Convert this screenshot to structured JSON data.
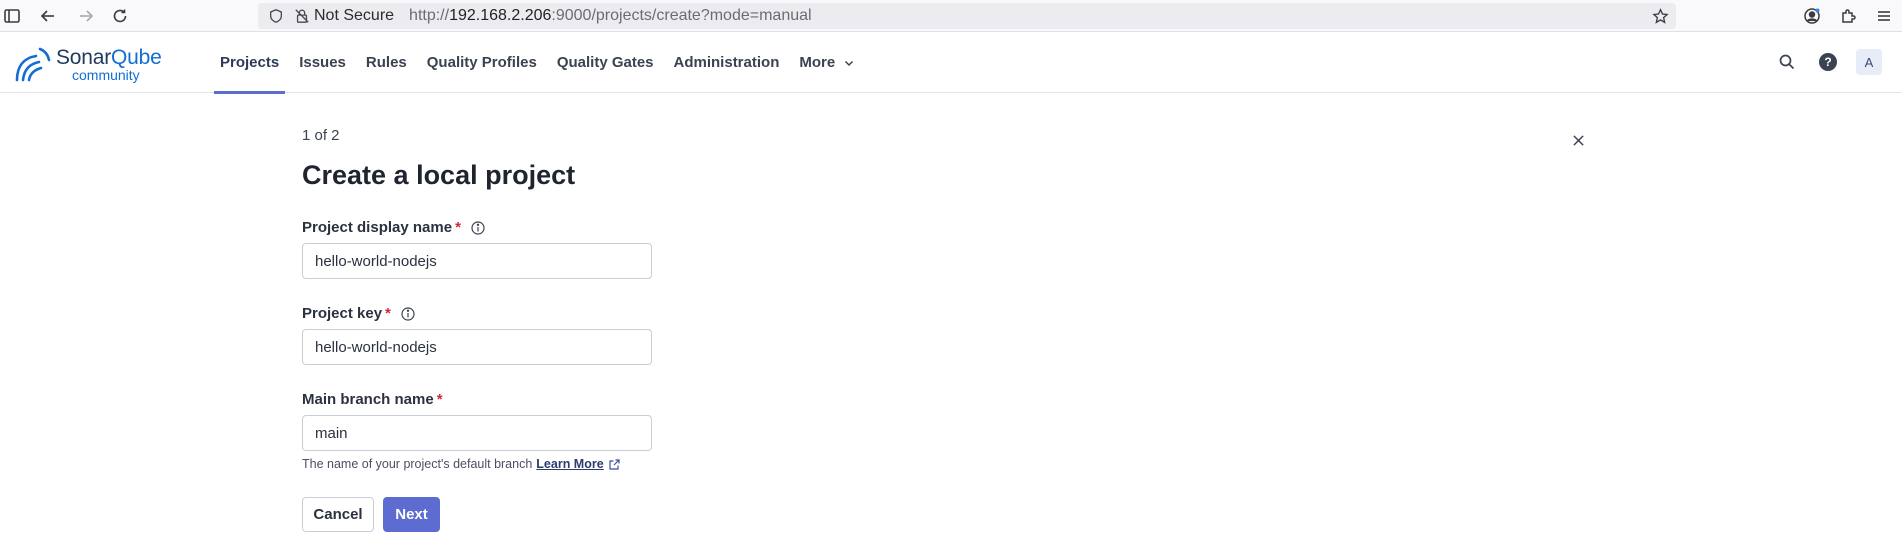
{
  "browser": {
    "not_secure_label": "Not Secure",
    "url_prefix": "http://",
    "url_host": "192.168.2.206",
    "url_rest": ":9000/projects/create?mode=manual"
  },
  "app": {
    "logo": {
      "brand_a": "Sonar",
      "brand_b": "Qube",
      "edition": "community"
    },
    "nav": [
      {
        "label": "Projects"
      },
      {
        "label": "Issues"
      },
      {
        "label": "Rules"
      },
      {
        "label": "Quality Profiles"
      },
      {
        "label": "Quality Gates"
      },
      {
        "label": "Administration"
      },
      {
        "label": "More"
      }
    ],
    "avatar_initial": "A",
    "help_glyph": "?"
  },
  "form": {
    "step": "1 of 2",
    "title": "Create a local project",
    "display_name": {
      "label": "Project display name",
      "required": "*",
      "value": "hello-world-nodejs"
    },
    "project_key": {
      "label": "Project key",
      "required": "*",
      "value": "hello-world-nodejs"
    },
    "main_branch": {
      "label": "Main branch name",
      "required": "*",
      "value": "main"
    },
    "hint": "The name of your project's default branch",
    "learn_more": "Learn More",
    "cancel_label": "Cancel",
    "next_label": "Next"
  },
  "colors": {
    "accent": "#5d6cd0",
    "required": "#d0283a",
    "brand_blue": "#126ed3"
  },
  "icons": [
    "sidebar-toggle-icon",
    "back-arrow-icon",
    "forward-arrow-icon",
    "reload-icon",
    "shield-icon",
    "insecure-lock-icon",
    "bookmark-star-icon",
    "account-icon",
    "extensions-icon",
    "menu-icon",
    "search-icon",
    "help-icon",
    "chevron-down-icon",
    "info-icon",
    "close-icon",
    "external-link-icon"
  ]
}
